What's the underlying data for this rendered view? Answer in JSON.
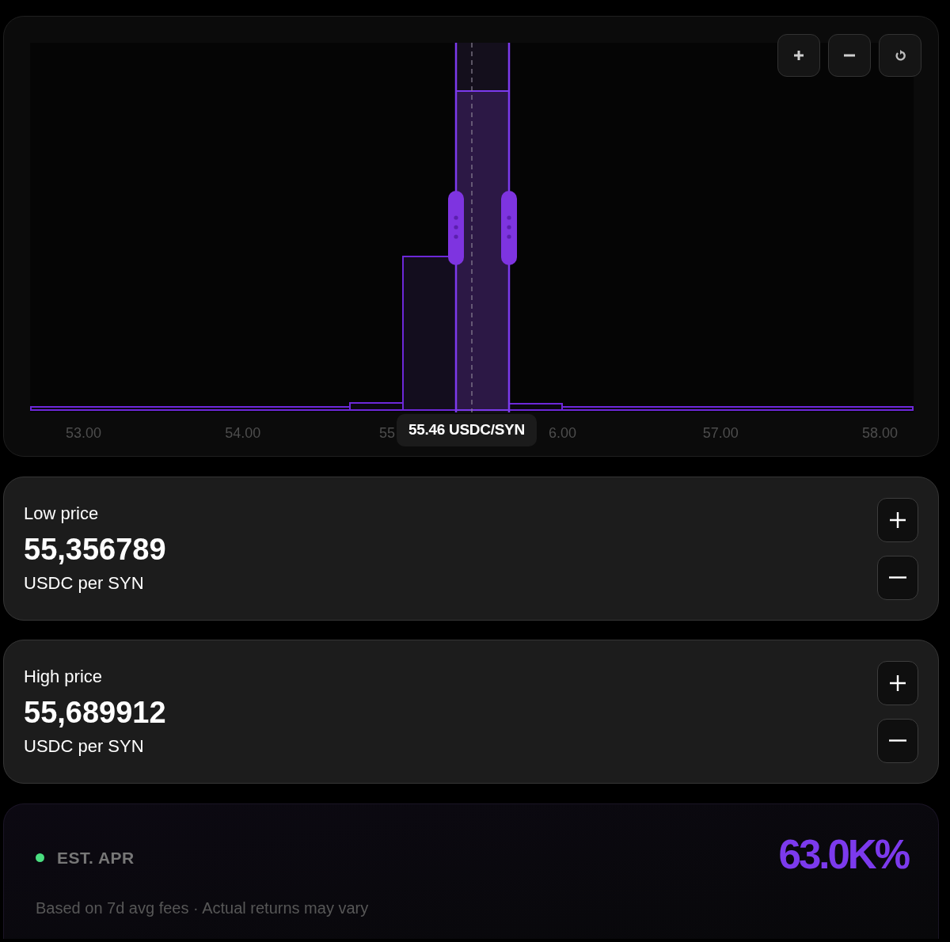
{
  "chart": {
    "controls": [
      {
        "kind": "zoom_in"
      },
      {
        "kind": "zoom_out"
      },
      {
        "kind": "reset"
      }
    ],
    "x_ticks": [
      "53.00",
      "54.00",
      "55",
      "6.00",
      "57.00",
      "58.00"
    ],
    "tooltip": "55.46 USDC/SYN"
  },
  "price_cards": [
    {
      "label": "Low price",
      "value": "55,356789",
      "unit": "USDC per SYN"
    },
    {
      "label": "High price",
      "value": "55,689912",
      "unit": "USDC per SYN"
    }
  ],
  "apr": {
    "label": "EST. APR",
    "value": "63.0K%",
    "note": "Based on 7d avg fees · Actual returns may vary"
  }
}
